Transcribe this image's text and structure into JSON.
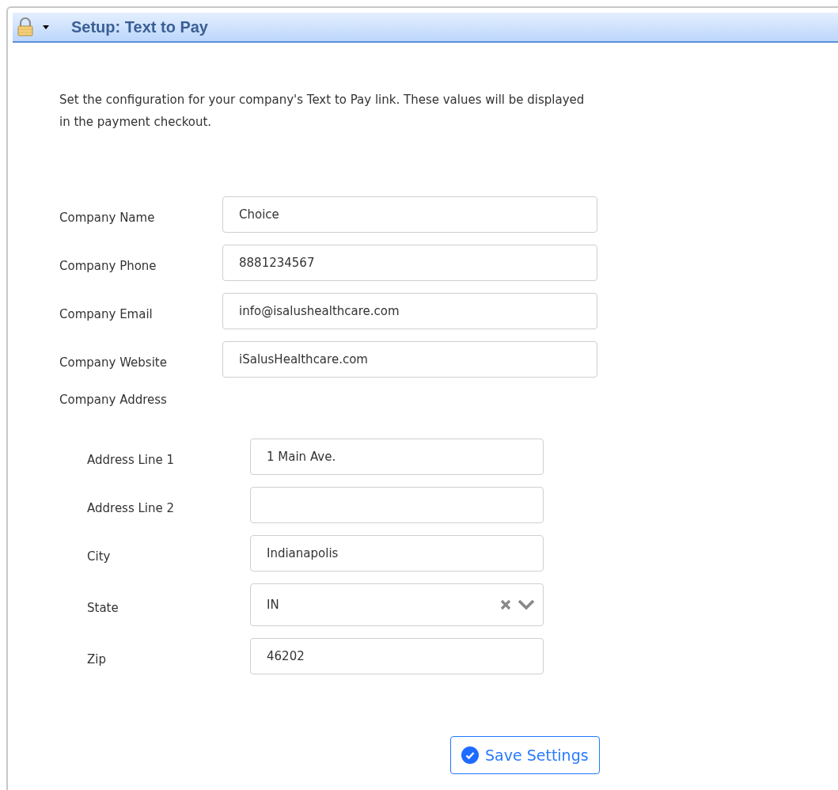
{
  "header": {
    "title": "Setup: Text to Pay"
  },
  "description": "Set the configuration for your company's Text to Pay link. These values will be displayed in the payment checkout.",
  "fields": [
    {
      "label": "Company Name",
      "value": "Choice"
    },
    {
      "label": "Company Phone",
      "value": "8881234567"
    },
    {
      "label": "Company Email",
      "value": "info@isalushealthcare.com"
    },
    {
      "label": "Company Website",
      "value": "iSalusHealthcare.com"
    }
  ],
  "address": {
    "label": "Company Address",
    "fields": [
      {
        "kind": "text",
        "label": "Address Line 1",
        "value": "1 Main Ave."
      },
      {
        "kind": "text",
        "label": "Address Line 2"
      },
      {
        "kind": "text",
        "label": "City",
        "value": "Indianapolis"
      },
      {
        "kind": "select",
        "label": "State",
        "value": "IN"
      },
      {
        "kind": "text",
        "label": "Zip",
        "value": "46202"
      }
    ]
  },
  "save_button": "Save Settings"
}
